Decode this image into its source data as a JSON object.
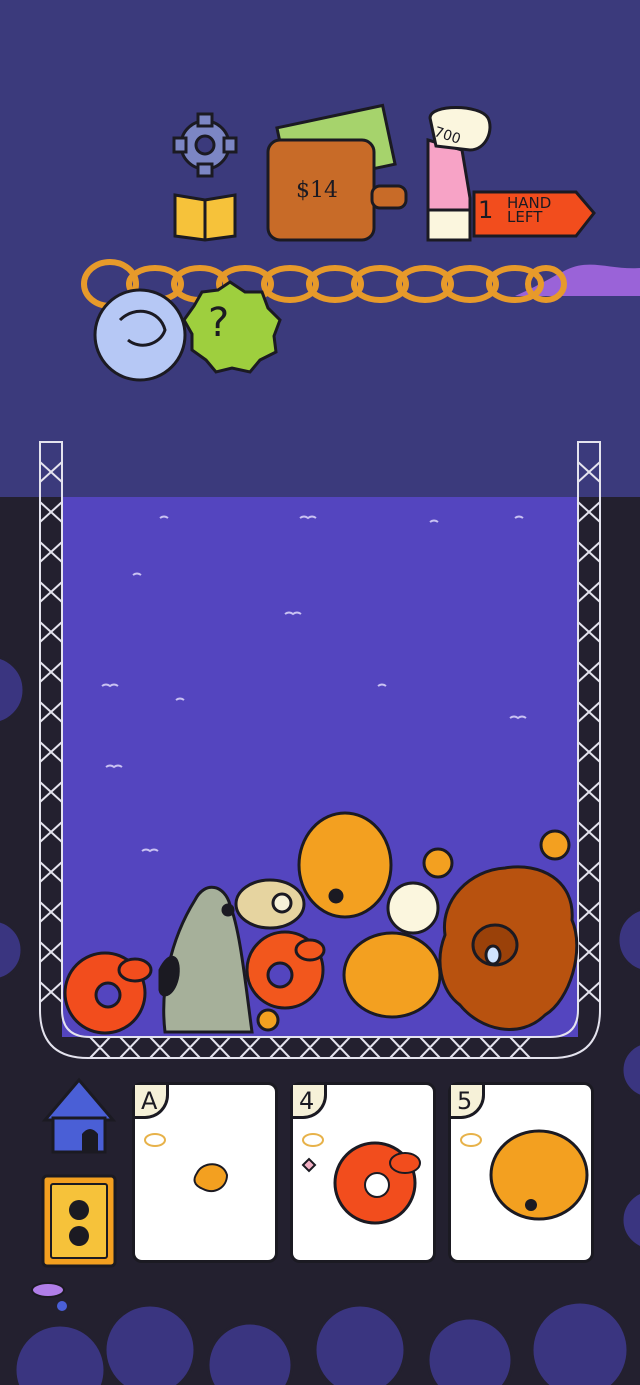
{
  "hud": {
    "money": "$14",
    "score": "700",
    "hands_left_count": "1",
    "hands_left_label": "HAND LEFT"
  },
  "charms": [
    "dog-charm",
    "mystery-charm"
  ],
  "mystery_charm_symbol": "?",
  "hand": [
    {
      "rank": "A",
      "dog": "small-chihuahua"
    },
    {
      "rank": "4",
      "dog": "orange-donut-dog"
    },
    {
      "rank": "5",
      "dog": "yellow-chubby-dog"
    }
  ],
  "colors": {
    "sky": "#3b3a7c",
    "water": "#5445bf",
    "ground": "#23202f",
    "accent_red": "#f24d1d",
    "accent_orange": "#f3a020"
  }
}
